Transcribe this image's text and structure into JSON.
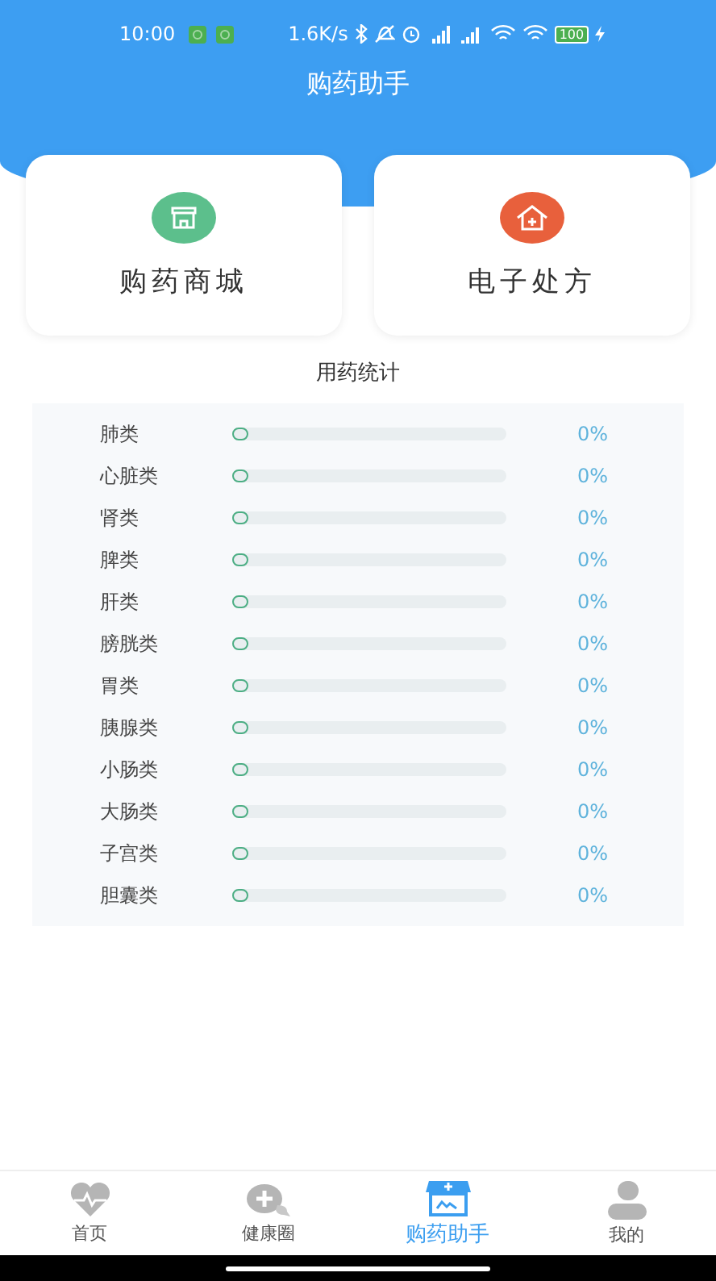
{
  "status_bar": {
    "time": "10:00",
    "speed": "1.6K/s",
    "battery": "100"
  },
  "header": {
    "title": "购药助手"
  },
  "cards": [
    {
      "label": "购药商城",
      "kind": "shop",
      "color": "#5cbf8c"
    },
    {
      "label": "电子处方",
      "kind": "prescription",
      "color": "#e8603c"
    }
  ],
  "stats": {
    "title": "用药统计",
    "rows": [
      {
        "name": "肺类",
        "level": 0,
        "reading": "0%"
      },
      {
        "name": "心脏类",
        "level": 0,
        "reading": "0%"
      },
      {
        "name": "肾类",
        "level": 0,
        "reading": "0%"
      },
      {
        "name": "脾类",
        "level": 0,
        "reading": "0%"
      },
      {
        "name": "肝类",
        "level": 0,
        "reading": "0%"
      },
      {
        "name": "膀胱类",
        "level": 0,
        "reading": "0%"
      },
      {
        "name": "胃类",
        "level": 0,
        "reading": "0%"
      },
      {
        "name": "胰腺类",
        "level": 0,
        "reading": "0%"
      },
      {
        "name": "小肠类",
        "level": 0,
        "reading": "0%"
      },
      {
        "name": "大肠类",
        "level": 0,
        "reading": "0%"
      },
      {
        "name": "子宫类",
        "level": 0,
        "reading": "0%"
      },
      {
        "name": "胆囊类",
        "level": 0,
        "reading": "0%"
      }
    ]
  },
  "tab_bar": [
    {
      "label": "首页",
      "kind": "home",
      "selected": false
    },
    {
      "label": "健康圈",
      "kind": "circle",
      "selected": false
    },
    {
      "label": "购药助手",
      "kind": "pharmacy",
      "selected": true
    },
    {
      "label": "我的",
      "kind": "profile",
      "selected": false
    }
  ]
}
